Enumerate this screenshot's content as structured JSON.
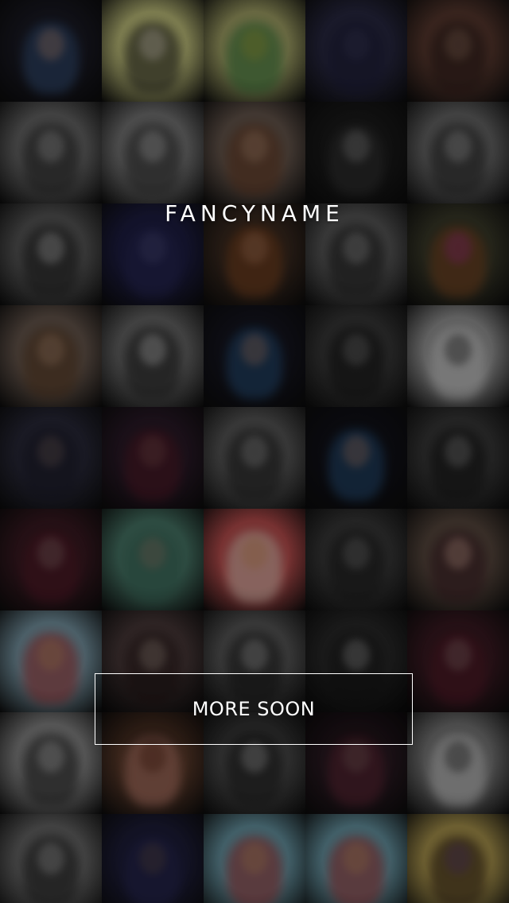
{
  "brand": {
    "title": "FANCYNAME"
  },
  "cta": {
    "label": "MORE SOON"
  },
  "background": {
    "tiles": [
      {
        "bg": "#1a1a24",
        "blob": "#3a5a88",
        "head": "#b08a7a"
      },
      {
        "bg": "#c8c880",
        "blob": "#1a1a1a",
        "head": "#d8d0c0"
      },
      {
        "bg": "#a8a86a",
        "blob": "#2f7a3a",
        "head": "#9aa23a"
      },
      {
        "bg": "#2a2a44",
        "blob": "#1c1c38",
        "head": "#3a3a5a"
      },
      {
        "bg": "#5a3a30",
        "blob": "#2a1a18",
        "head": "#8a6a58"
      },
      {
        "bg": "#6a6a6a",
        "blob": "#222222",
        "head": "#aaaaaa"
      },
      {
        "bg": "#7a7a7a",
        "blob": "#2a2a2a",
        "head": "#bbbbbb"
      },
      {
        "bg": "#6a5a50",
        "blob": "#6a3a20",
        "head": "#b08a70"
      },
      {
        "bg": "#1a1a1a",
        "blob": "#3a3a3a",
        "head": "#8a8a8a"
      },
      {
        "bg": "#6a6a6a",
        "blob": "#222222",
        "head": "#aaaaaa"
      },
      {
        "bg": "#5a5a5a",
        "blob": "#1a1a1a",
        "head": "#bbbbbb"
      },
      {
        "bg": "#1e1e44",
        "blob": "#2a2a5a",
        "head": "#4a4a7a"
      },
      {
        "bg": "#3a2a20",
        "blob": "#8a4a20",
        "head": "#b07a5a"
      },
      {
        "bg": "#5a5a5a",
        "blob": "#1a1a1a",
        "head": "#999999"
      },
      {
        "bg": "#3a3a2a",
        "blob": "#8a4a20",
        "head": "#a0307a"
      },
      {
        "bg": "#6a5a50",
        "blob": "#5a3a20",
        "head": "#b08a70"
      },
      {
        "bg": "#6a6a6a",
        "blob": "#1a1a1a",
        "head": "#cccccc"
      },
      {
        "bg": "#15151f",
        "blob": "#2a5a8a",
        "head": "#a07a6a"
      },
      {
        "bg": "#3a3a3a",
        "blob": "#111111",
        "head": "#777777"
      },
      {
        "bg": "#9a9a9a",
        "blob": "#e0e0e0",
        "head": "#333333"
      },
      {
        "bg": "#2a2a3a",
        "blob": "#1a1a28",
        "head": "#6a5a5a"
      },
      {
        "bg": "#2a1a28",
        "blob": "#5a1a28",
        "head": "#7a4a4a"
      },
      {
        "bg": "#5a5a5a",
        "blob": "#1a1a1a",
        "head": "#999999"
      },
      {
        "bg": "#111118",
        "blob": "#2a5a8a",
        "head": "#a07a6a"
      },
      {
        "bg": "#3a3a3a",
        "blob": "#111111",
        "head": "#888888"
      },
      {
        "bg": "#3a1a22",
        "blob": "#5a1a2a",
        "head": "#8a6a6a"
      },
      {
        "bg": "#4a7a6a",
        "blob": "#3a6a5a",
        "head": "#8a7a6a"
      },
      {
        "bg": "#c05050",
        "blob": "#f0e0d0",
        "head": "#d09060"
      },
      {
        "bg": "#3a3a3a",
        "blob": "#1a1a1a",
        "head": "#777777"
      },
      {
        "bg": "#5a4a40",
        "blob": "#3a1a22",
        "head": "#caa090"
      },
      {
        "bg": "#7a9aa8",
        "blob": "#b03030",
        "head": "#c08a60"
      },
      {
        "bg": "#4a3a3a",
        "blob": "#2a1a1a",
        "head": "#9a8a80"
      },
      {
        "bg": "#5a5a5a",
        "blob": "#1a1a1a",
        "head": "#aaaaaa"
      },
      {
        "bg": "#2a2a2a",
        "blob": "#1a1a1a",
        "head": "#999999"
      },
      {
        "bg": "#3a1a22",
        "blob": "#5a1a2a",
        "head": "#8a6a6a"
      },
      {
        "bg": "#8a8a8a",
        "blob": "#1a1a1a",
        "head": "#bbbbbb"
      },
      {
        "bg": "#5a3a2a",
        "blob": "#d08a7a",
        "head": "#5a2a1a"
      },
      {
        "bg": "#4a4a4a",
        "blob": "#1a1a1a",
        "head": "#aaaaaa"
      },
      {
        "bg": "#2a1a22",
        "blob": "#6a2a3a",
        "head": "#7a5a5a"
      },
      {
        "bg": "#7a7a7a",
        "blob": "#e0e0e0",
        "head": "#333333"
      },
      {
        "bg": "#6a6a6a",
        "blob": "#1a1a1a",
        "head": "#aaaaaa"
      },
      {
        "bg": "#1e1e3a",
        "blob": "#2a2a5a",
        "head": "#5a4a4a"
      },
      {
        "bg": "#6a9aa8",
        "blob": "#b03030",
        "head": "#c08a60"
      },
      {
        "bg": "#6a9aa8",
        "blob": "#b03030",
        "head": "#c08a60"
      },
      {
        "bg": "#b09a50",
        "blob": "#2a1a10",
        "head": "#5a3a6a"
      }
    ]
  }
}
